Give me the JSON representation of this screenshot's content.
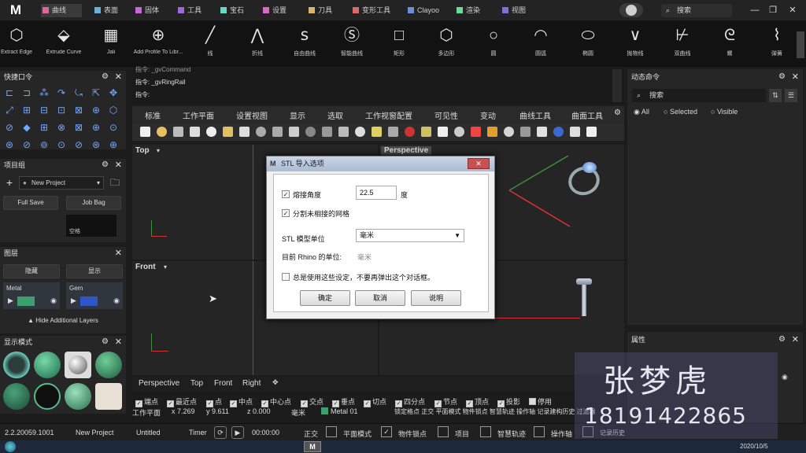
{
  "top_tabs": [
    {
      "label": "曲线",
      "color": "#d96a9a",
      "active": true
    },
    {
      "label": "表面",
      "color": "#6ab0d9"
    },
    {
      "label": "固体",
      "color": "#c76ad9"
    },
    {
      "label": "工具",
      "color": "#9a6ad9"
    },
    {
      "label": "宝石",
      "color": "#6ad9c3"
    },
    {
      "label": "设置",
      "color": "#d96ac3"
    },
    {
      "label": "刀具",
      "color": "#d9b56a"
    },
    {
      "label": "变形工具",
      "color": "#d96a6a"
    },
    {
      "label": "Clayoo",
      "color": "#6a8fd9"
    },
    {
      "label": "渲染",
      "color": "#6ad99a"
    },
    {
      "label": "视图",
      "color": "#8a6ad9"
    }
  ],
  "app_logo": "M",
  "search_top": "搜索",
  "ribbon_tools": [
    {
      "label": "Extract Edge",
      "icon": "cube-icon"
    },
    {
      "label": "Extrude Curve",
      "icon": "extrude-icon"
    },
    {
      "label": "Jali",
      "icon": "grid-icon"
    },
    {
      "label": "Add Profile To Libr...",
      "icon": "profile-icon"
    },
    {
      "label": "线",
      "icon": "line-icon"
    },
    {
      "label": "折线",
      "icon": "polyline-icon"
    },
    {
      "label": "自由曲线",
      "icon": "freecurve-icon"
    },
    {
      "label": "智能曲线",
      "icon": "smartcurve-icon"
    },
    {
      "label": "矩形",
      "icon": "rectangle-icon"
    },
    {
      "label": "多边形",
      "icon": "polygon-icon"
    },
    {
      "label": "圆",
      "icon": "circle-icon"
    },
    {
      "label": "圆弧",
      "icon": "arc-icon"
    },
    {
      "label": "椭圆",
      "icon": "ellipse-icon"
    },
    {
      "label": "抛物线",
      "icon": "parabola-icon"
    },
    {
      "label": "双曲线",
      "icon": "hyperbola-icon"
    },
    {
      "label": "螺",
      "icon": "spiral-icon"
    },
    {
      "label": "弹簧",
      "icon": "spring-icon"
    }
  ],
  "left": {
    "quick_title": "快捷口令",
    "project_title": "项目组",
    "new_project": "New Project",
    "full_save": "Full Save",
    "job_bag": "Job Bag",
    "blank_label": "空格",
    "layers_title": "图层",
    "hide": "隐藏",
    "show": "显示",
    "layer1": "Metal",
    "layer2": "Gem",
    "hide_layers": "Hide Additional Layers",
    "display_title": "显示模式"
  },
  "command": {
    "line1": "指令: _gvCommand",
    "line2": "指令: _gvRingRail",
    "line3": "指令:"
  },
  "toolbar_tabs": [
    "标准",
    "工作平面",
    "设置视图",
    "显示",
    "选取",
    "工作视窗配置",
    "可见性",
    "变动",
    "曲线工具",
    "曲面工具"
  ],
  "viewports": {
    "top": "Top",
    "perspective": "Perspective",
    "front": "Front"
  },
  "dialog": {
    "title": "STL 导入选项",
    "weld_label": "熔接角度",
    "weld_value": "22.5",
    "degree": "度",
    "split_label": "分割未相接的网格",
    "unit_label": "STL 模型单位",
    "unit_value": "毫米",
    "current_label": "目前 Rhino 的单位:",
    "current_value": "毫米",
    "always_label": "总是使用这些设定，不要再弹出这个对话框。",
    "ok": "确定",
    "cancel": "取消",
    "help": "说明"
  },
  "right": {
    "title": "动态命令",
    "search": "搜索",
    "radio_all": "All",
    "radio_selected": "Selected",
    "radio_visible": "Visible",
    "props_title": "属性"
  },
  "vp_tabs": [
    "Perspective",
    "Top",
    "Front",
    "Right"
  ],
  "osnaps": [
    "端点",
    "最近点",
    "点",
    "中点",
    "中心点",
    "交点",
    "垂点",
    "切点",
    "四分点",
    "节点",
    "顶点",
    "投影",
    "停用"
  ],
  "coords": {
    "plane": "工作平面",
    "x": "x 7.269",
    "y": "y 9.611",
    "z": "z 0.000",
    "unit": "毫米",
    "layer": "Metal 01",
    "modes": "锁定格点 正交 平面模式 物件锁点 智慧轨迹 操作轴 记录建构历史 过滤器"
  },
  "status": {
    "version": "2.2.20059.1001",
    "project": "New Project",
    "file": "Untitled",
    "timer": "Timer",
    "time": "00:00:00",
    "ortho": "正交",
    "planar": "平面模式",
    "osnap": "物件锁点",
    "project_mode": "项目",
    "smarttrack": "智慧轨迹",
    "gumball": "操作轴",
    "history": "记录历史"
  },
  "watermark": {
    "name": "张梦虎",
    "phone": "18191422865"
  },
  "taskbar_date": "2020/10/5"
}
